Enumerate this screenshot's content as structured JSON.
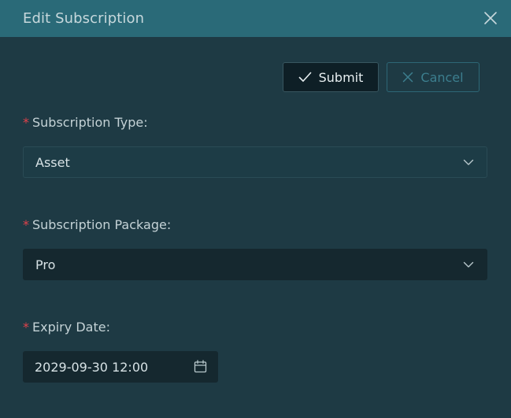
{
  "dialog": {
    "title": "Edit Subscription"
  },
  "toolbar": {
    "submit_label": "Submit",
    "cancel_label": "Cancel"
  },
  "form": {
    "subscription_type": {
      "label": "Subscription Type",
      "colon": ":",
      "value": "Asset"
    },
    "subscription_package": {
      "label": "Subscription Package",
      "colon": ":",
      "value": "Pro"
    },
    "expiry_date": {
      "label": "Expiry Date",
      "colon": ":",
      "value": "2029-09-30 12:00"
    },
    "required_mark": "*"
  },
  "icons": {
    "close": "close-icon",
    "submit": "checkmark-icon",
    "cancel": "close-icon",
    "dropdown": "chevron-down-icon",
    "calendar": "calendar-icon"
  },
  "colors": {
    "header": "#2a6a78",
    "background": "#1e3a44",
    "required": "#e0424b"
  }
}
